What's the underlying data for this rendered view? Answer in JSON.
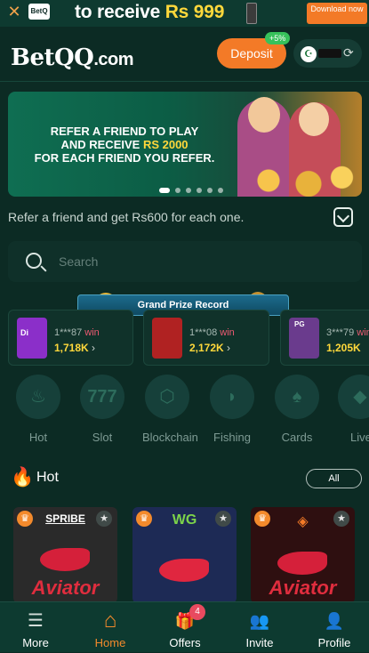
{
  "promo": {
    "text_prefix": "to receive ",
    "amount": "Rs 999",
    "download_label": "Download now",
    "logo_text": "BetQ"
  },
  "header": {
    "logo_main": "BetQQ",
    "logo_suffix": ".com",
    "deposit_label": "Deposit",
    "deposit_bonus": "+5%"
  },
  "banner": {
    "line1": "REFER A FRIEND TO PLAY",
    "line2_prefix": "AND RECEIVE ",
    "line2_amount": "RS 2000",
    "line3": "FOR EACH FRIEND YOU REFER.",
    "slides": 6,
    "active_slide": 1
  },
  "refer": {
    "text": "Refer a friend and get Rs600 for each one."
  },
  "search": {
    "placeholder": "Search"
  },
  "grand_prize": {
    "title": "Grand Prize Record",
    "winners": [
      {
        "user": "1***87",
        "win_label": "win",
        "amount": "1,718K",
        "thumb_color": "#8b2fc9",
        "thumb_label": "Di"
      },
      {
        "user": "1***08",
        "win_label": "win",
        "amount": "2,172K",
        "thumb_color": "#b02222",
        "thumb_label": ""
      },
      {
        "user": "3***79",
        "win_label": "win",
        "amount": "1,205K",
        "thumb_color": "#6a3b8d",
        "thumb_label": "PG"
      }
    ]
  },
  "categories": [
    {
      "label": "Hot",
      "icon": "flame-icon",
      "glyph": "♨",
      "active": true
    },
    {
      "label": "Slot",
      "icon": "slot-777-icon",
      "glyph": "777",
      "active": false
    },
    {
      "label": "Blockchain",
      "icon": "blockchain-cube-icon",
      "glyph": "⬡",
      "active": false
    },
    {
      "label": "Fishing",
      "icon": "fish-icon",
      "glyph": "◗",
      "active": false
    },
    {
      "label": "Cards",
      "icon": "cards-icon",
      "glyph": "♠",
      "active": false
    },
    {
      "label": "Live",
      "icon": "live-icon",
      "glyph": "◆",
      "active": false
    }
  ],
  "hot_section": {
    "title": "Hot",
    "all_label": "All",
    "games": [
      {
        "brand": "SPRIBE",
        "title": "Aviator",
        "bg": "#2a2a2a"
      },
      {
        "brand": "WG",
        "title": "",
        "bg": "#1d2a55"
      },
      {
        "brand": "",
        "title": "Aviator",
        "bg": "#2e0f10"
      }
    ]
  },
  "bottom_nav": [
    {
      "label": "More",
      "icon": "menu-icon",
      "glyph": "☰",
      "active": false
    },
    {
      "label": "Home",
      "icon": "home-icon",
      "glyph": "⌂",
      "active": true
    },
    {
      "label": "Offers",
      "icon": "gift-icon",
      "glyph": "🎁",
      "active": false,
      "badge": "4"
    },
    {
      "label": "Invite",
      "icon": "invite-users-icon",
      "glyph": "👥",
      "active": false
    },
    {
      "label": "Profile",
      "icon": "profile-icon",
      "glyph": "👤",
      "active": false
    }
  ],
  "colors": {
    "background": "#0c2b24",
    "accent_orange": "#f37a27",
    "highlight_yellow": "#ffd83b",
    "active_category": "#1fa78b",
    "win_pink": "#ee5a72"
  }
}
